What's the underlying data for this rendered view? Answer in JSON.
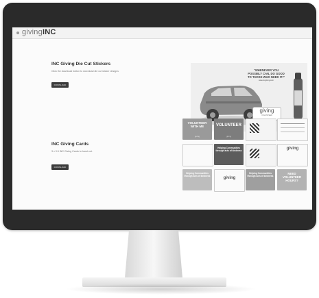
{
  "site": {
    "logo_prefix": "giving",
    "logo_suffix": "INC"
  },
  "sections": [
    {
      "title": "INC Giving Die Cut Stickers",
      "description": "Click the download button to download die cut sticker designs",
      "button_label": "DOWNLOAD"
    },
    {
      "title": "INC Giving Cards",
      "description": "3 x 3.5 INC Giving Cards to hand out.",
      "button_label": "DOWNLOAD"
    }
  ],
  "hero": {
    "quote_line1": "“WHENEVER YOU",
    "quote_line2": "POSSIBLY CAN, DO GOOD",
    "quote_line3": "TO THOSE WHO NEED IT!”",
    "quote_url": "www.incgiving.com",
    "badge_logo": "giving",
    "badge_sub": "VOLUNTEER"
  },
  "cards": [
    {
      "text": "VOLUNTEER WITH ME",
      "sub": "giving"
    },
    {
      "text": "VOLUNTEER",
      "sub": "giving"
    },
    {
      "text": "QR",
      "sub": ""
    },
    {
      "text": "",
      "sub": ""
    },
    {
      "text": "",
      "sub": ""
    },
    {
      "text": "giving",
      "sub": ""
    },
    {
      "text": "Helping Communities through acts of kindness",
      "sub": ""
    },
    {
      "text": "QR",
      "sub": ""
    },
    {
      "text": "",
      "sub": ""
    },
    {
      "text": "giving",
      "sub": ""
    },
    {
      "text": "Helping Communities through acts of kindness",
      "sub": ""
    },
    {
      "text": "",
      "sub": ""
    },
    {
      "text": "giving",
      "sub": ""
    },
    {
      "text": "Helping Communities through acts of kindness",
      "sub": ""
    },
    {
      "text": "giving",
      "sub": ""
    },
    {
      "text": "NEED VOLUNTEER HOURS?",
      "sub": ""
    }
  ]
}
